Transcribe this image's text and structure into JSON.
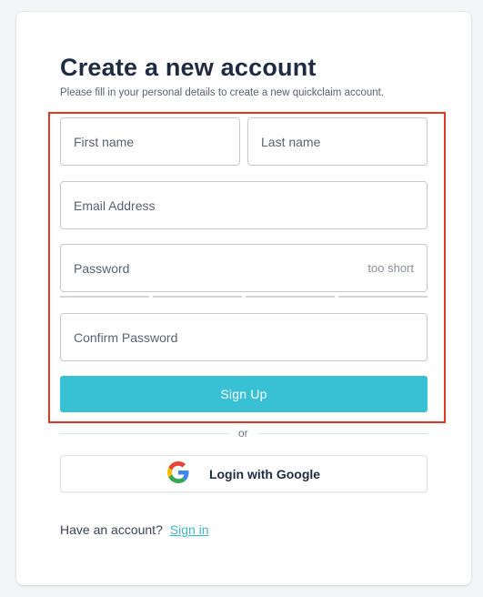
{
  "page": {
    "title": "Create a new account",
    "subtitle": "Please fill in your personal details to create a new quickclaim account."
  },
  "form": {
    "first_name_placeholder": "First name",
    "last_name_placeholder": "Last name",
    "email_placeholder": "Email Address",
    "password_placeholder": "Password",
    "password_strength_hint": "too short",
    "password_strength_level": 0,
    "password_strength_segments": 4,
    "confirm_password_placeholder": "Confirm Password",
    "signup_label": "Sign Up"
  },
  "divider": {
    "label": "or"
  },
  "google": {
    "label": "Login with Google",
    "icon": "google-icon"
  },
  "footer": {
    "prompt": "Have an account?",
    "signin_label": "Sign in"
  },
  "colors": {
    "accent": "#38c1d4",
    "link": "#38b7cc",
    "title": "#1f2a44",
    "highlight": "#e2381f"
  }
}
